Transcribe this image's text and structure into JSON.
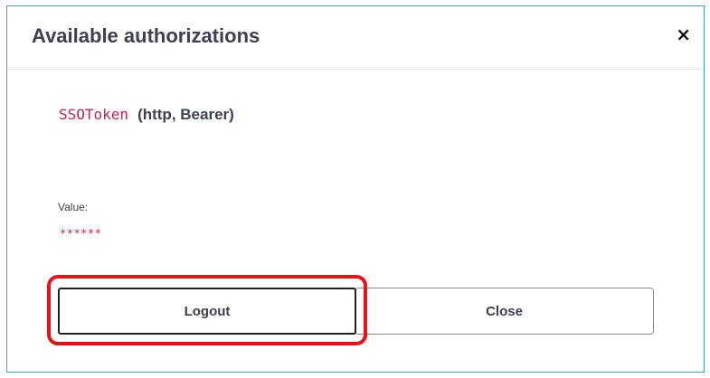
{
  "dialog": {
    "title": "Available authorizations",
    "close_glyph": "×"
  },
  "auth": {
    "scheme_name": "SSOToken",
    "scheme_type": "(http, Bearer)",
    "value_label": "Value:",
    "value_masked": "******"
  },
  "buttons": {
    "logout_label": "Logout",
    "close_label": "Close"
  },
  "colors": {
    "frame_border": "#3fa8a8",
    "scheme_name": "#c0254e",
    "highlight": "#e8121b",
    "text": "#3b4151"
  },
  "icons": {
    "dialog_close": "close-icon"
  }
}
